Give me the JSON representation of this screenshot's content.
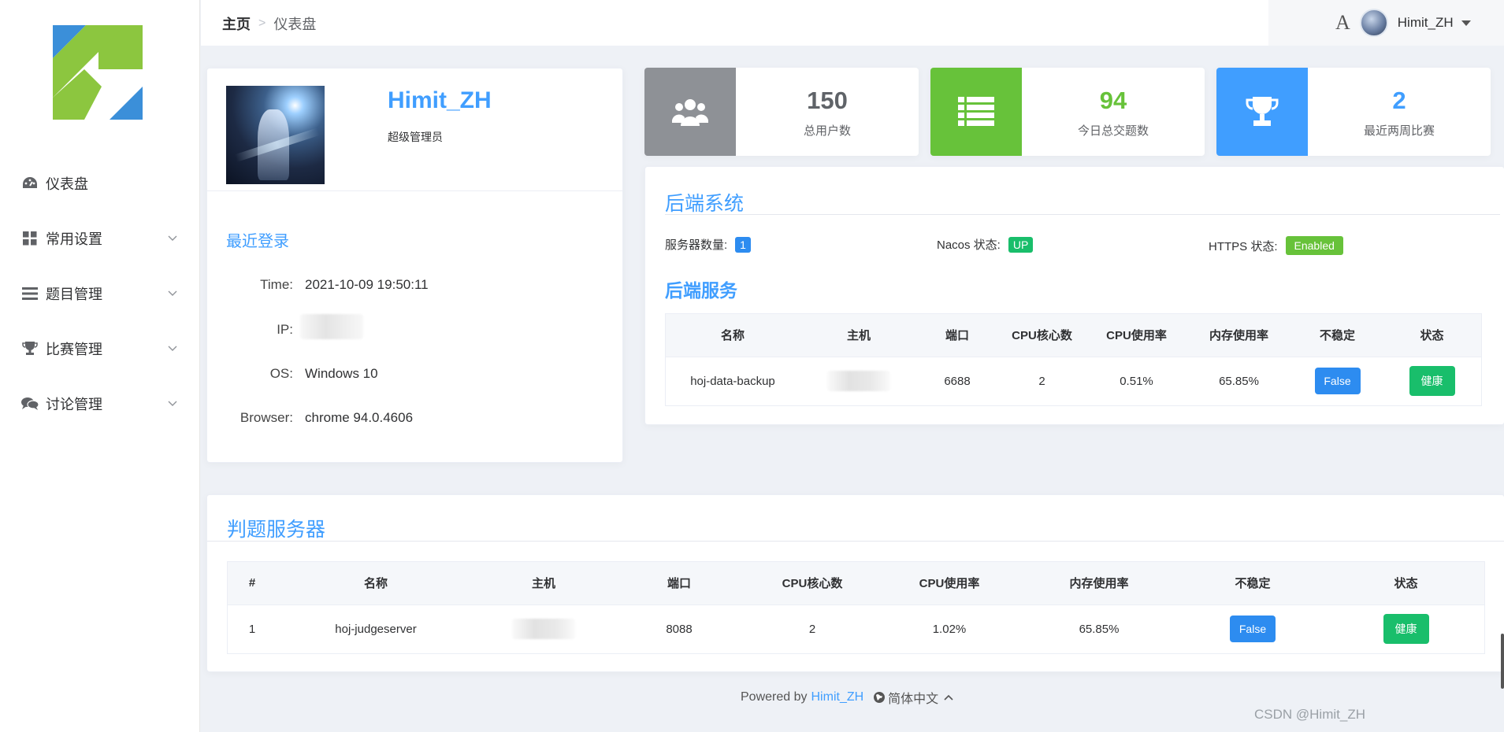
{
  "sidebar": {
    "items": [
      {
        "label": "仪表盘",
        "icon": "dashboard-icon",
        "has_submenu": false
      },
      {
        "label": "常用设置",
        "icon": "grid-icon",
        "has_submenu": true
      },
      {
        "label": "题目管理",
        "icon": "list-icon",
        "has_submenu": true
      },
      {
        "label": "比赛管理",
        "icon": "trophy-icon",
        "has_submenu": true
      },
      {
        "label": "讨论管理",
        "icon": "chat-icon",
        "has_submenu": true
      }
    ]
  },
  "header": {
    "breadcrumb": {
      "home": "主页",
      "current": "仪表盘"
    },
    "font_button": "A",
    "username": "Himit_ZH"
  },
  "profile": {
    "name": "Himit_ZH",
    "role": "超级管理员",
    "recent_login_title": "最近登录",
    "time_label": "Time:",
    "time": "2021-10-09 19:50:11",
    "ip_label": "IP:",
    "os_label": "OS:",
    "os": "Windows 10",
    "browser_label": "Browser:",
    "browser": "chrome 94.0.4606"
  },
  "stats": [
    {
      "value": "150",
      "label": "总用户数",
      "color": "#8e9196",
      "value_color": "#5f6368",
      "icon": "users-icon"
    },
    {
      "value": "94",
      "label": "今日总交题数",
      "color": "#67c23a",
      "value_color": "#67c23a",
      "icon": "list-icon"
    },
    {
      "value": "2",
      "label": "最近两周比赛",
      "color": "#409eff",
      "value_color": "#409eff",
      "icon": "trophy-icon"
    }
  ],
  "backend": {
    "title": "后端系统",
    "server_count_label": "服务器数量:",
    "server_count": "1",
    "nacos_label": "Nacos 状态:",
    "nacos_status": "UP",
    "https_label": "HTTPS 状态:",
    "https_status": "Enabled",
    "service_title": "后端服务",
    "columns": [
      "名称",
      "主机",
      "端口",
      "CPU核心数",
      "CPU使用率",
      "内存使用率",
      "不稳定",
      "状态"
    ],
    "rows": [
      {
        "name": "hoj-data-backup",
        "port": "6688",
        "cores": "2",
        "cpu": "0.51%",
        "mem": "65.85%",
        "unstable": "False",
        "status": "健康"
      }
    ]
  },
  "judge": {
    "title": "判题服务器",
    "columns": [
      "#",
      "名称",
      "主机",
      "端口",
      "CPU核心数",
      "CPU使用率",
      "内存使用率",
      "不稳定",
      "状态"
    ],
    "rows": [
      {
        "index": "1",
        "name": "hoj-judgeserver",
        "port": "8088",
        "cores": "2",
        "cpu": "1.02%",
        "mem": "65.85%",
        "unstable": "False",
        "status": "健康"
      }
    ]
  },
  "footer": {
    "powered_by": "Powered by",
    "author": "Himit_ZH",
    "language": "简体中文"
  },
  "watermark": "CSDN @Himit_ZH",
  "colors": {
    "primary": "#409eff",
    "success": "#19be6b",
    "button_blue": "#2d8cf0",
    "green_tag": "#67c23a"
  }
}
